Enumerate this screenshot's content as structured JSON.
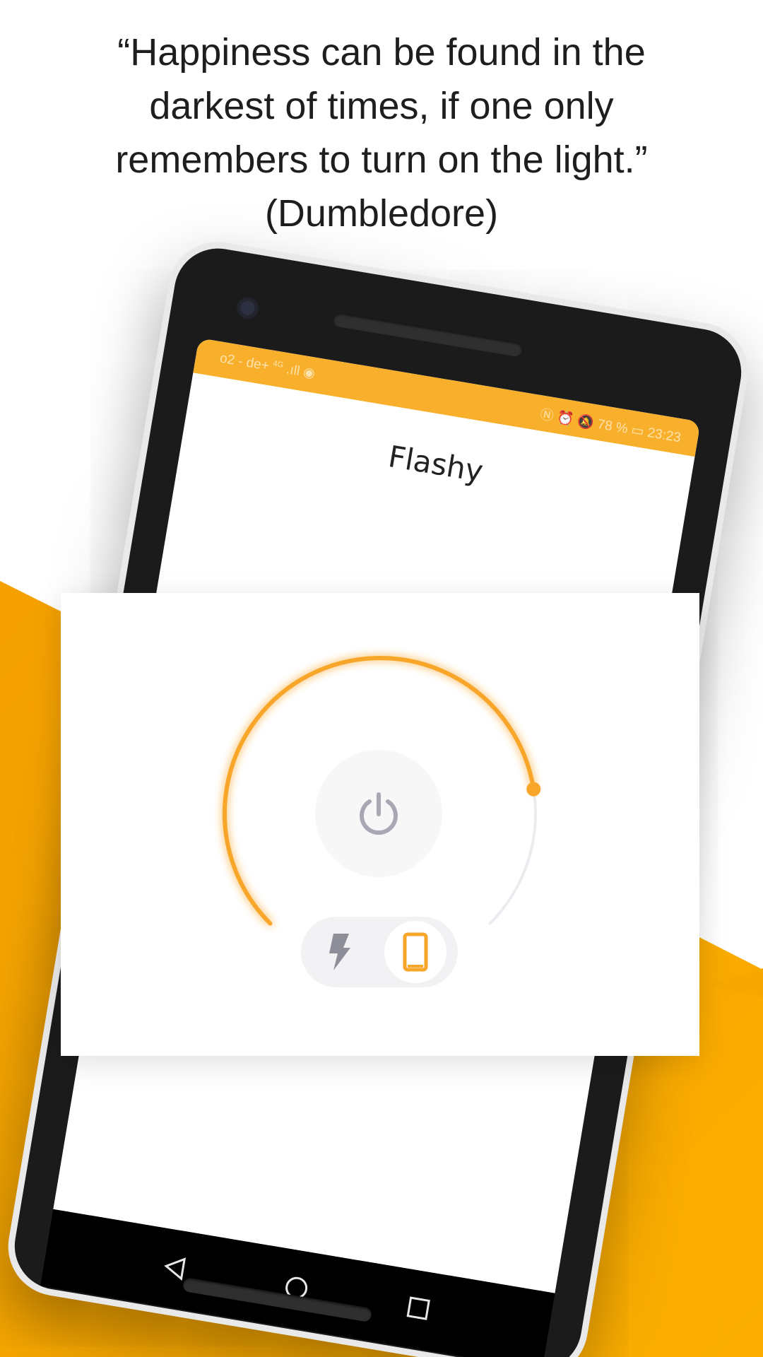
{
  "quote": {
    "lines": [
      "“Happiness can be found in the",
      "darkest of times, if one only",
      "remembers to turn on the light.”",
      "(Dumbledore)"
    ]
  },
  "phone": {
    "status_bar": {
      "carrier": "o2 - de+",
      "network": "4G",
      "battery_percent": "78 %",
      "time": "23:23"
    },
    "app_title": "Flashy"
  },
  "colors": {
    "accent": "#F8A62A",
    "background_orange": "#F7A800",
    "status_bar": "#F8B02C",
    "icon_gray": "#A8A8B4"
  },
  "dial": {
    "brightness_fraction": 0.8
  },
  "mode_toggle": {
    "options": [
      "flash-icon",
      "screen-light-icon"
    ],
    "selected": "screen-light-icon"
  },
  "icons": {
    "power": "power-icon",
    "nav_back": "triangle-back-icon",
    "nav_home": "circle-home-icon",
    "nav_recents": "square-recents-icon"
  }
}
